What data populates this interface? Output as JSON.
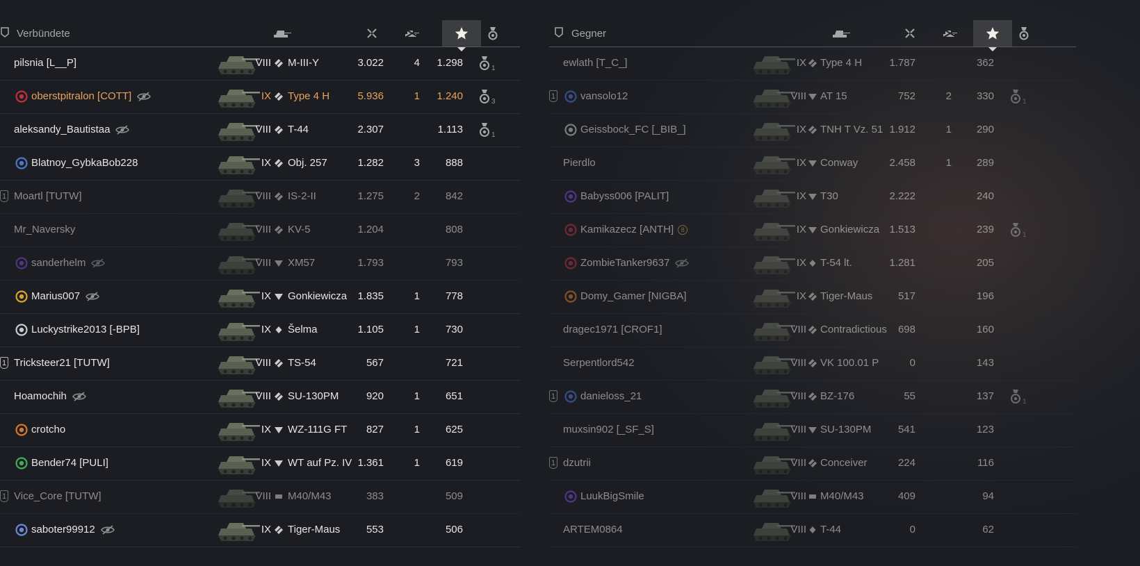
{
  "colors": {
    "highlight": "#e8a25a",
    "text": "#e8e6df",
    "muted": "#a4a6a8"
  },
  "allies": {
    "title": "Verbündete",
    "rows": [
      {
        "player": "pilsnia [L__P]",
        "clan_icon": "none",
        "platoon": "",
        "hidden": false,
        "tier": "VIII",
        "class": "heavy",
        "vehicle": "M-III-Y",
        "damage": "3.022",
        "kills": "4",
        "xp": "1.298",
        "medal": "1",
        "dim": false
      },
      {
        "player": "oberstpitralon [COTT]",
        "clan_icon": "red-clan-icon",
        "platoon": "",
        "hidden": true,
        "tier": "IX",
        "class": "heavy",
        "vehicle": "Type 4 H",
        "damage": "5.936",
        "kills": "1",
        "xp": "1.240",
        "medal": "3",
        "dim": false,
        "highlight": true
      },
      {
        "player": "aleksandy_Bautistaa",
        "clan_icon": "none",
        "platoon": "",
        "hidden": true,
        "tier": "VIII",
        "class": "heavy",
        "vehicle": "T-44",
        "damage": "2.307",
        "kills": "",
        "xp": "1.113",
        "medal": "1",
        "dim": false
      },
      {
        "player": "Blatnoy_GybkaBob228",
        "clan_icon": "blue-clan-icon",
        "platoon": "",
        "hidden": false,
        "tier": "IX",
        "class": "heavy",
        "vehicle": "Obj. 257",
        "damage": "1.282",
        "kills": "3",
        "xp": "888",
        "medal": "",
        "dim": false
      },
      {
        "player": "Moartl [TUTW]",
        "clan_icon": "none",
        "platoon": "1",
        "hidden": false,
        "tier": "VIII",
        "class": "heavy",
        "vehicle": "IS-2-II",
        "damage": "1.275",
        "kills": "2",
        "xp": "842",
        "medal": "",
        "dim": true
      },
      {
        "player": "Mr_Naversky",
        "clan_icon": "none",
        "platoon": "",
        "hidden": false,
        "tier": "VIII",
        "class": "heavy",
        "vehicle": "KV-5",
        "damage": "1.204",
        "kills": "",
        "xp": "808",
        "medal": "",
        "dim": true
      },
      {
        "player": "sanderhelm",
        "clan_icon": "purple-clan-icon",
        "platoon": "",
        "hidden": true,
        "tier": "VIII",
        "class": "td",
        "vehicle": "XM57",
        "damage": "1.793",
        "kills": "",
        "xp": "793",
        "medal": "",
        "dim": true
      },
      {
        "player": "Marius007",
        "clan_icon": "gold-clan-icon",
        "platoon": "",
        "hidden": true,
        "tier": "IX",
        "class": "td",
        "vehicle": "Gonkiewicza",
        "damage": "1.835",
        "kills": "1",
        "xp": "778",
        "medal": "",
        "dim": false
      },
      {
        "player": "Luckystrike2013 [-BPB]",
        "clan_icon": "wing-clan-icon",
        "platoon": "",
        "hidden": false,
        "tier": "IX",
        "class": "light",
        "vehicle": "Šelma",
        "damage": "1.105",
        "kills": "1",
        "xp": "730",
        "medal": "",
        "dim": false
      },
      {
        "player": "Tricksteer21 [TUTW]",
        "clan_icon": "none",
        "platoon": "1",
        "hidden": false,
        "tier": "VIII",
        "class": "heavy",
        "vehicle": "TS-54",
        "damage": "567",
        "kills": "",
        "xp": "721",
        "medal": "",
        "dim": false
      },
      {
        "player": "Hoamochih",
        "clan_icon": "none",
        "platoon": "",
        "hidden": true,
        "tier": "VIII",
        "class": "heavy",
        "vehicle": "SU-130PM",
        "damage": "920",
        "kills": "1",
        "xp": "651",
        "medal": "",
        "dim": false
      },
      {
        "player": "crotcho",
        "clan_icon": "orange-clan-icon",
        "platoon": "",
        "hidden": false,
        "tier": "IX",
        "class": "td",
        "vehicle": "WZ-111G FT",
        "damage": "827",
        "kills": "1",
        "xp": "625",
        "medal": "",
        "dim": false
      },
      {
        "player": "Bender74 [PULI]",
        "clan_icon": "green-clan-icon",
        "platoon": "",
        "hidden": false,
        "tier": "IX",
        "class": "td",
        "vehicle": "WT auf Pz. IV",
        "damage": "1.361",
        "kills": "1",
        "xp": "619",
        "medal": "",
        "dim": false
      },
      {
        "player": "Vice_Core [TUTW]",
        "clan_icon": "none",
        "platoon": "1",
        "hidden": false,
        "tier": "VIII",
        "class": "spg",
        "vehicle": "M40/M43",
        "damage": "383",
        "kills": "",
        "xp": "509",
        "medal": "",
        "dim": true
      },
      {
        "player": "saboter99912",
        "clan_icon": "snow-clan-icon",
        "platoon": "",
        "hidden": true,
        "tier": "IX",
        "class": "heavy",
        "vehicle": "Tiger-Maus",
        "damage": "553",
        "kills": "",
        "xp": "506",
        "medal": "",
        "dim": false
      }
    ]
  },
  "enemies": {
    "title": "Gegner",
    "rows": [
      {
        "player": "ewlath [T_C_]",
        "clan_icon": "none",
        "platoon": "",
        "hidden": false,
        "tier": "IX",
        "class": "heavy",
        "vehicle": "Type 4 H",
        "damage": "1.787",
        "kills": "",
        "xp": "362",
        "medal": "",
        "dim": true
      },
      {
        "player": "vansolo12",
        "clan_icon": "blue-clan-icon",
        "platoon": "1",
        "hidden": false,
        "tier": "VIII",
        "class": "td",
        "vehicle": "AT 15",
        "damage": "752",
        "kills": "2",
        "xp": "330",
        "medal": "1",
        "dim": true
      },
      {
        "player": "Geissbock_FC [_BIB_]",
        "clan_icon": "white-clan-icon",
        "platoon": "",
        "hidden": false,
        "tier": "IX",
        "class": "heavy",
        "vehicle": "TNH T Vz. 51",
        "damage": "1.912",
        "kills": "1",
        "xp": "290",
        "medal": "",
        "dim": true
      },
      {
        "player": "Pierdlo",
        "clan_icon": "none",
        "platoon": "",
        "hidden": false,
        "tier": "IX",
        "class": "td",
        "vehicle": "Conway",
        "damage": "2.458",
        "kills": "1",
        "xp": "289",
        "medal": "",
        "dim": true
      },
      {
        "player": "Babyss006 [PALIT]",
        "clan_icon": "purple-clan-icon",
        "platoon": "",
        "hidden": false,
        "tier": "IX",
        "class": "td",
        "vehicle": "T30",
        "damage": "2.222",
        "kills": "",
        "xp": "240",
        "medal": "",
        "dim": true
      },
      {
        "player": "Kamikazecz [ANTH]",
        "clan_icon": "red-clan-icon",
        "platoon": "",
        "hidden": false,
        "badge": "8",
        "tier": "IX",
        "class": "td",
        "vehicle": "Gonkiewicza",
        "damage": "1.513",
        "kills": "",
        "xp": "239",
        "medal": "1",
        "dim": true
      },
      {
        "player": "ZombieTanker9637",
        "clan_icon": "red-clan-icon",
        "platoon": "",
        "hidden": true,
        "tier": "IX",
        "class": "light",
        "vehicle": "T-54 lt.",
        "damage": "1.281",
        "kills": "",
        "xp": "205",
        "medal": "",
        "dim": true
      },
      {
        "player": "Domy_Gamer [NIGBA]",
        "clan_icon": "orange-clan-icon",
        "platoon": "",
        "hidden": false,
        "tier": "IX",
        "class": "heavy",
        "vehicle": "Tiger-Maus",
        "damage": "517",
        "kills": "",
        "xp": "196",
        "medal": "",
        "dim": true
      },
      {
        "player": "dragec1971 [CROF1]",
        "clan_icon": "none",
        "platoon": "",
        "hidden": false,
        "tier": "VIII",
        "class": "heavy",
        "vehicle": "Contradictious",
        "damage": "698",
        "kills": "",
        "xp": "160",
        "medal": "",
        "dim": true
      },
      {
        "player": "Serpentlord542",
        "clan_icon": "none",
        "platoon": "",
        "hidden": false,
        "tier": "VIII",
        "class": "heavy",
        "vehicle": "VK 100.01 P",
        "damage": "0",
        "kills": "",
        "xp": "143",
        "medal": "",
        "dim": true
      },
      {
        "player": "danieloss_21",
        "clan_icon": "blue-clan-icon",
        "platoon": "1",
        "hidden": false,
        "tier": "VIII",
        "class": "heavy",
        "vehicle": "BZ-176",
        "damage": "55",
        "kills": "",
        "xp": "137",
        "medal": "1",
        "dim": true
      },
      {
        "player": "muxsin902 [_SF_S]",
        "clan_icon": "none",
        "platoon": "",
        "hidden": false,
        "tier": "VIII",
        "class": "td",
        "vehicle": "SU-130PM",
        "damage": "541",
        "kills": "",
        "xp": "123",
        "medal": "",
        "dim": true
      },
      {
        "player": "dzutrii",
        "clan_icon": "none",
        "platoon": "1",
        "hidden": false,
        "tier": "VIII",
        "class": "heavy",
        "vehicle": "Conceiver",
        "damage": "224",
        "kills": "",
        "xp": "116",
        "medal": "",
        "dim": true
      },
      {
        "player": "LuukBigSmile",
        "clan_icon": "purple-clan-icon",
        "platoon": "",
        "hidden": false,
        "tier": "VIII",
        "class": "spg",
        "vehicle": "M40/M43",
        "damage": "409",
        "kills": "",
        "xp": "94",
        "medal": "",
        "dim": true
      },
      {
        "player": "ARTEM0864",
        "clan_icon": "none",
        "platoon": "",
        "hidden": false,
        "tier": "VIII",
        "class": "light",
        "vehicle": "T-44",
        "damage": "0",
        "kills": "",
        "xp": "62",
        "medal": "",
        "dim": true
      }
    ]
  }
}
